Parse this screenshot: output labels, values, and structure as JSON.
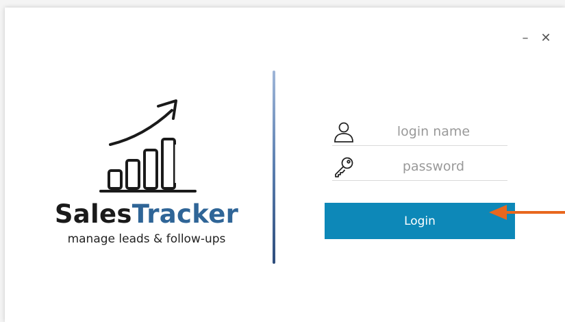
{
  "window": {
    "minimize_label": "–",
    "close_label": "✕"
  },
  "brand": {
    "name_part1": "Sales",
    "name_part2": "Tracker",
    "tagline": "manage leads & follow-ups",
    "logo_icon": "growth-chart-icon"
  },
  "login": {
    "username_placeholder": "login name",
    "username_value": "",
    "username_icon": "user-icon",
    "password_placeholder": "password",
    "password_value": "",
    "password_icon": "key-icon",
    "button_label": "Login"
  },
  "colors": {
    "brand_dark": "#1a1a1a",
    "brand_blue": "#2f6597",
    "button": "#0d88b8",
    "arrow": "#e8671e"
  }
}
